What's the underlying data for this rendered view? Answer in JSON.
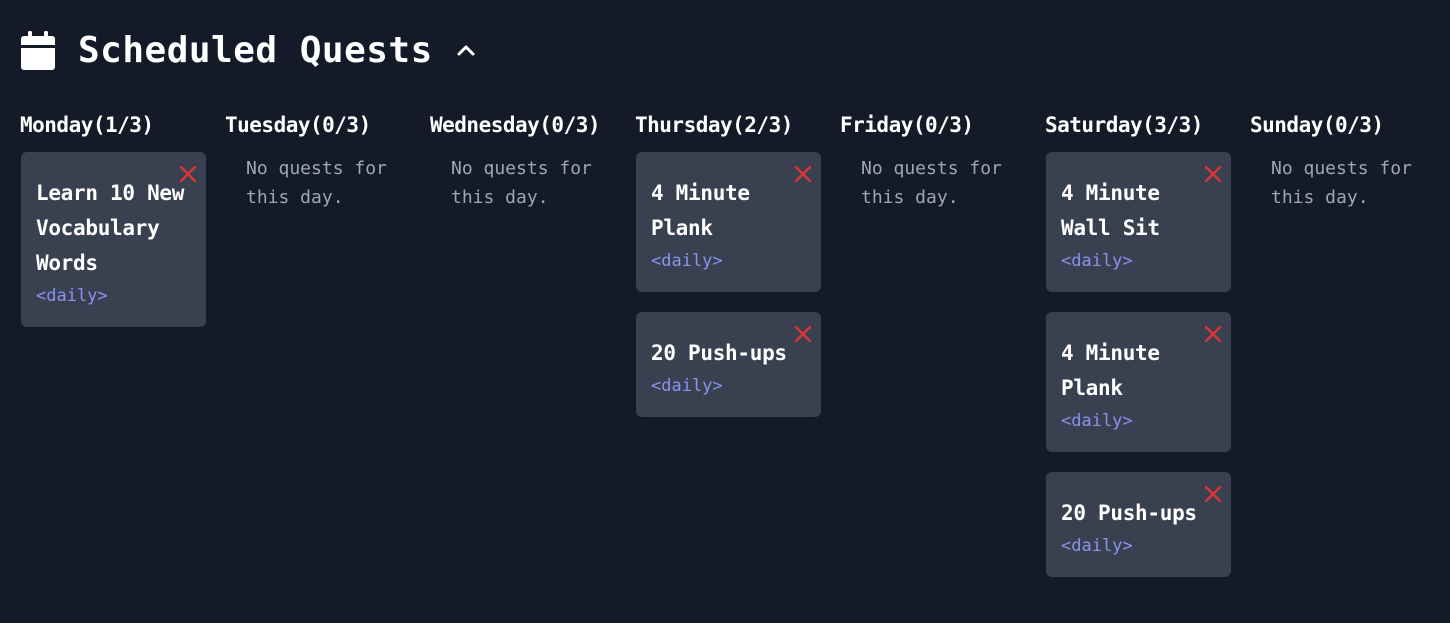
{
  "header": {
    "title": "Scheduled Quests",
    "calendar_icon": "calendar-icon",
    "collapse_icon": "chevron-up-icon"
  },
  "colors": {
    "background": "#141a28",
    "card": "#394150",
    "tag": "#8c92f0",
    "remove": "#d93636",
    "muted": "#a0a6b2"
  },
  "days": [
    {
      "title": "Monday(1/3)",
      "empty_text": "",
      "quests": [
        {
          "title": "Learn 10 New Vocabulary Words",
          "tag": "<daily>"
        }
      ]
    },
    {
      "title": "Tuesday(0/3)",
      "empty_text": "No quests for this day.",
      "quests": []
    },
    {
      "title": "Wednesday(0/3)",
      "empty_text": "No quests for this day.",
      "quests": []
    },
    {
      "title": "Thursday(2/3)",
      "empty_text": "",
      "quests": [
        {
          "title": "4 Minute Plank",
          "tag": "<daily>"
        },
        {
          "title": "20 Push-ups",
          "tag": "<daily>"
        }
      ]
    },
    {
      "title": "Friday(0/3)",
      "empty_text": "No quests for this day.",
      "quests": []
    },
    {
      "title": "Saturday(3/3)",
      "empty_text": "",
      "quests": [
        {
          "title": "4 Minute Wall Sit",
          "tag": "<daily>"
        },
        {
          "title": "4 Minute Plank",
          "tag": "<daily>"
        },
        {
          "title": "20 Push-ups",
          "tag": "<daily>"
        }
      ]
    },
    {
      "title": "Sunday(0/3)",
      "empty_text": "No quests for this day.",
      "quests": []
    }
  ]
}
